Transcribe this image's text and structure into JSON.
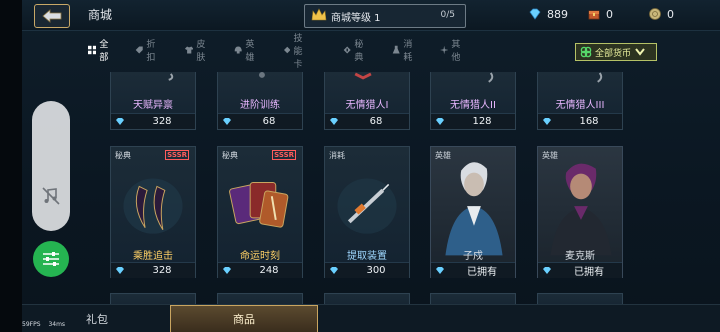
{
  "header": {
    "title": "商城",
    "shop_level_label": "商城等级 1",
    "shop_level_progress": "0/5",
    "currencies": [
      {
        "icon": "diamond-icon",
        "value": "889"
      },
      {
        "icon": "chest-icon",
        "value": "0"
      },
      {
        "icon": "coin-icon",
        "value": "0"
      }
    ]
  },
  "filters": {
    "tabs": [
      {
        "label": "全部",
        "icon": "grid-icon",
        "active": true
      },
      {
        "label": "折扣",
        "icon": "tag-icon"
      },
      {
        "label": "皮肤",
        "icon": "shirt-icon"
      },
      {
        "label": "英雄",
        "icon": "helmet-icon"
      },
      {
        "label": "技能卡",
        "icon": "card-icon"
      },
      {
        "label": "秘典",
        "icon": "book-icon"
      },
      {
        "label": "消耗",
        "icon": "flask-icon"
      },
      {
        "label": "其他",
        "icon": "sparkle-icon"
      }
    ],
    "currency_select": "全部货币"
  },
  "items_top": [
    {
      "name": "天赋异禀",
      "price": "328"
    },
    {
      "name": "进阶训练",
      "price": "68"
    },
    {
      "name": "无情猎人I",
      "price": "68"
    },
    {
      "name": "无情猎人II",
      "price": "128"
    },
    {
      "name": "无情猎人III",
      "price": "168"
    }
  ],
  "items_mid": [
    {
      "tag": "秘典",
      "tier": "SSSR",
      "name": "乘胜追击",
      "price": "328"
    },
    {
      "tag": "秘典",
      "tier": "SSSR",
      "name": "命运时刻",
      "price": "248"
    },
    {
      "tag": "消耗",
      "tier": "",
      "name": "提取装置",
      "price": "300"
    },
    {
      "tag": "英雄",
      "tier": "",
      "name": "子戍",
      "status": "已拥有"
    },
    {
      "tag": "英雄",
      "tier": "",
      "name": "麦克斯",
      "status": "已拥有"
    }
  ],
  "bottom_tabs": [
    {
      "label": "礼包",
      "active": false
    },
    {
      "label": "商品",
      "active": true
    }
  ],
  "debug": {
    "fps": "59FPS",
    "ms": "34ms"
  },
  "colors": {
    "accent_gold": "#c8a867",
    "diamond": "#6ad0ff",
    "owned_green": "#25b451"
  }
}
